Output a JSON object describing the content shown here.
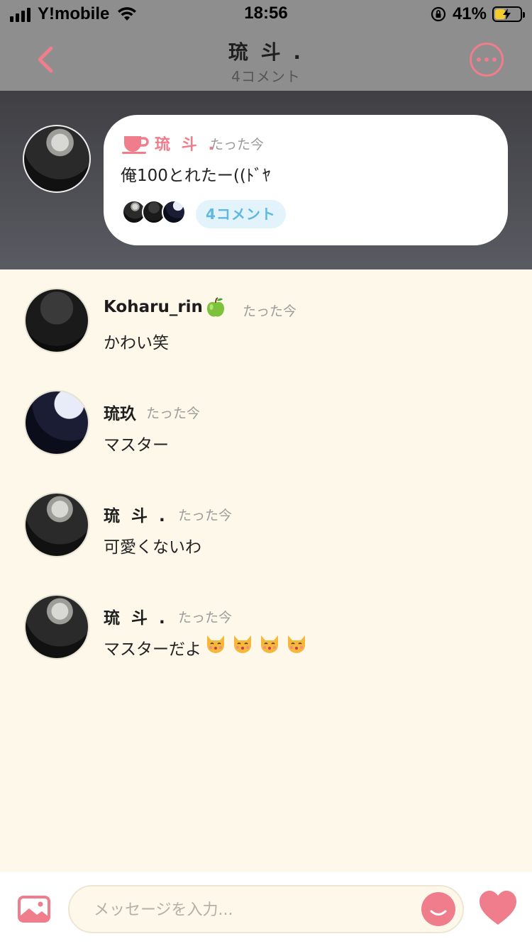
{
  "status_bar": {
    "carrier": "Y!mobile",
    "time": "18:56",
    "battery_percent": "41%",
    "battery_level": 0.41,
    "charging": true
  },
  "nav": {
    "title": "琉 斗 .",
    "subtitle": "4コメント",
    "back_icon": "chevron-left-icon",
    "more_icon": "more-horizontal-icon"
  },
  "post": {
    "author": "琉 斗 .",
    "time": "たった今",
    "text": "俺100とれたー((ﾄﾞﾔ",
    "comment_count_label": "4コメント",
    "cup_icon": "cup-icon"
  },
  "comments": [
    {
      "name": "Koharu_rin",
      "emoji": "green-apple-icon",
      "time": "たった今",
      "text": "かわい笑"
    },
    {
      "name": "琉玖",
      "time": "たった今",
      "text": "マスター"
    },
    {
      "name": "琉 斗 .",
      "time": "たった今",
      "text": "可愛くないわ"
    },
    {
      "name": "琉 斗 .",
      "time": "たった今",
      "text": "マスターだよ",
      "trailing_emoji": [
        "kissing-cat-icon",
        "kissing-cat-icon",
        "kissing-cat-icon",
        "kissing-cat-icon"
      ]
    }
  ],
  "input_bar": {
    "placeholder": "メッセージを入力...",
    "value": "",
    "image_icon": "image-icon",
    "smile_icon": "smile-icon",
    "heart_icon": "heart-icon"
  },
  "colors": {
    "accent_pink": "#ef7d8c",
    "accent_blue": "#5fb8e2",
    "background_cream": "#fdf8ea",
    "header_gray": "#8e8e8e"
  }
}
